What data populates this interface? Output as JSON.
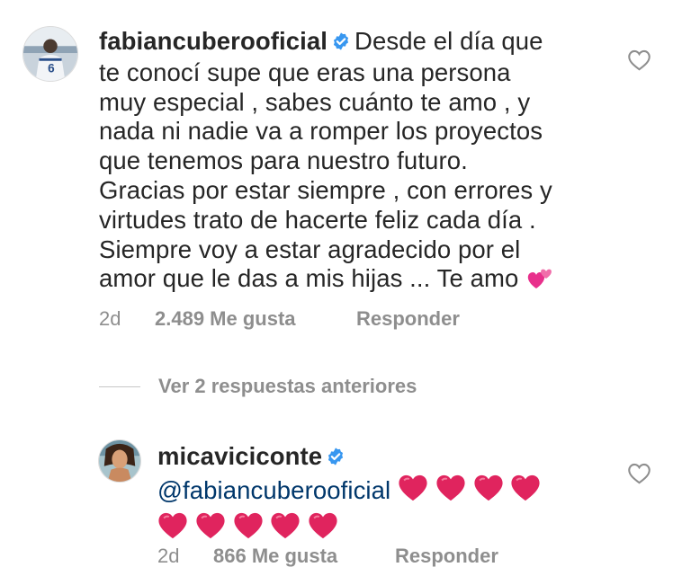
{
  "comment1": {
    "username": "fabiancuberooficial",
    "text_lines": [
      "Desde el día que",
      "te conocí supe que eras una persona",
      "muy especial , sabes cuánto te amo , y",
      "nada ni nadie va a romper los proyectos",
      "que tenemos para nuestro futuro.",
      "Gracias por estar siempre , con errores y",
      "virtudes trato de hacerte feliz cada día .",
      "Siempre voy a estar agradecido por el",
      "amor que le das a mis hijas ... Te amo"
    ],
    "time": "2d",
    "likes": "2.489 Me gusta",
    "reply": "Responder"
  },
  "view_replies": "Ver 2 respuestas anteriores",
  "comment2": {
    "username": "micaviciconte",
    "mention": "@fabiancuberooficial",
    "time": "2d",
    "likes": "866 Me gusta",
    "reply": "Responder"
  },
  "icons": {
    "verified": "verified-badge-icon",
    "like": "heart-outline-icon",
    "emoji_two_hearts": "two-hearts-emoji",
    "emoji_red_heart": "red-heart-emoji"
  },
  "colors": {
    "text": "#262626",
    "secondary": "#8e8e8e",
    "mention": "#00376b",
    "verified": "#3897f0",
    "heart": "#e0245e"
  }
}
